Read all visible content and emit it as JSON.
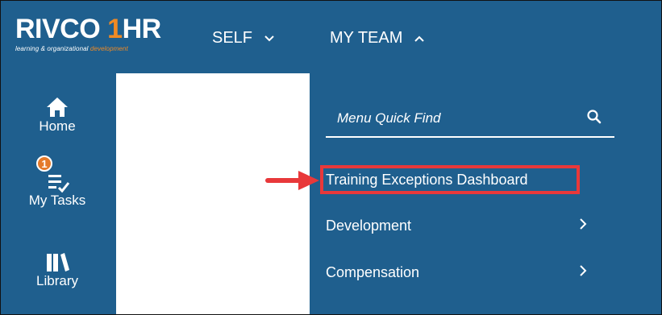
{
  "logo": {
    "brand_main": "RIVCO",
    "brand_number": "1",
    "brand_hr": "HR",
    "tagline_main": "learning & organizational",
    "tagline_accent": "development"
  },
  "topnav": {
    "self_label": "SELF",
    "my_team_label": "MY TEAM"
  },
  "sidebar": {
    "items": [
      {
        "label": "Home",
        "icon": "home-icon"
      },
      {
        "label": "My Tasks",
        "icon": "tasks-icon",
        "badge": "1"
      },
      {
        "label": "Library",
        "icon": "library-icon"
      }
    ]
  },
  "menu": {
    "search_placeholder": "Menu Quick Find",
    "items": [
      {
        "label": "Training Exceptions Dashboard",
        "has_submenu": false,
        "highlighted": true
      },
      {
        "label": "Development",
        "has_submenu": true
      },
      {
        "label": "Compensation",
        "has_submenu": true
      }
    ]
  },
  "colors": {
    "background": "#1f5f8e",
    "accent_orange": "#f08a24",
    "badge": "#e47a2a",
    "annotation_red": "#e8383a"
  }
}
